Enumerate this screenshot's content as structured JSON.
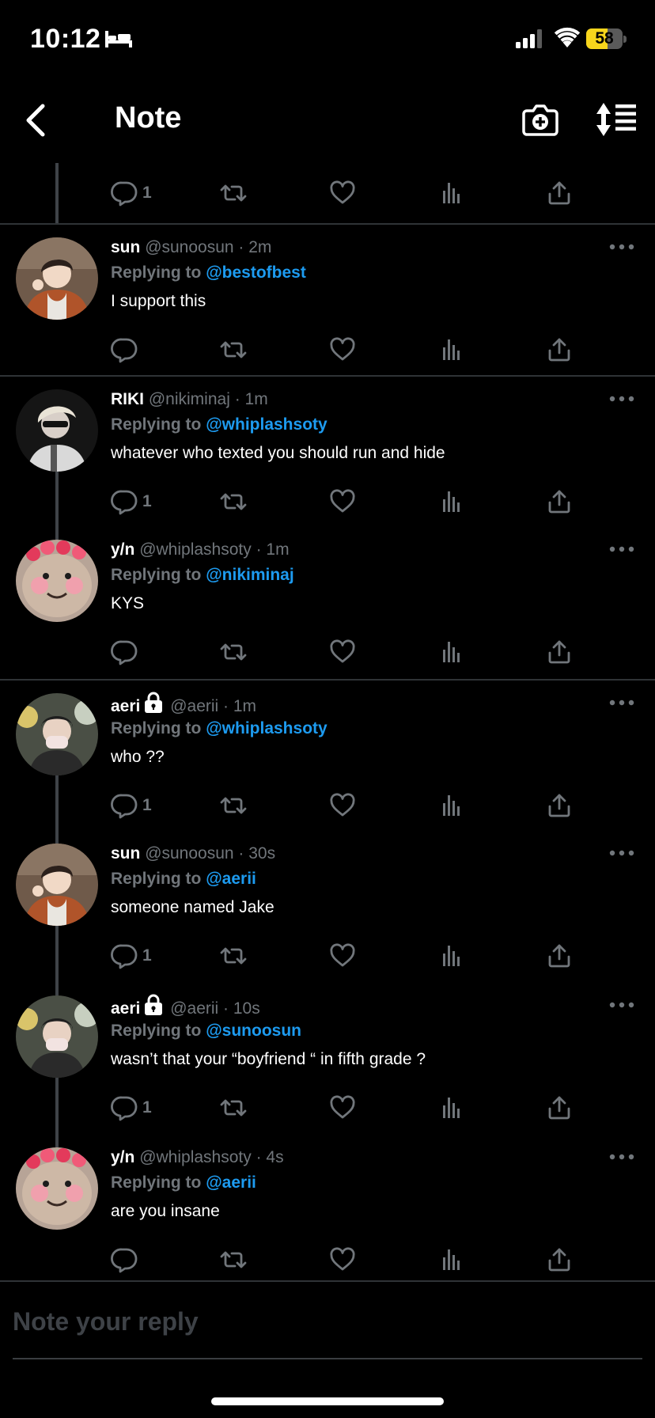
{
  "status_bar": {
    "time": "10:12",
    "battery_level": "58",
    "battery_fraction": 0.58
  },
  "nav": {
    "title": "Note"
  },
  "top_actions": {
    "reply_count": "1"
  },
  "posts": [
    {
      "name": "sun",
      "handle": "@sunoosun · 2m",
      "locked": false,
      "replying_label": "Replying to",
      "mention": "@bestofbest",
      "text": "I support this",
      "reply_count": "",
      "avatar": "sun"
    },
    {
      "name": "RIKI",
      "handle": "@nikiminaj · 1m",
      "locked": false,
      "replying_label": "Replying to",
      "mention": "@whiplashsoty",
      "text": "whatever who texted you should run and hide",
      "reply_count": "1",
      "avatar": "riki"
    },
    {
      "name": "y/n",
      "handle": "@whiplashsoty · 1m",
      "locked": false,
      "replying_label": "Replying to",
      "mention": "@nikiminaj",
      "text": "KYS",
      "reply_count": "",
      "avatar": "yn"
    },
    {
      "name": "aeri",
      "handle": "@aerii · 1m",
      "locked": true,
      "replying_label": "Replying to",
      "mention": "@whiplashsoty",
      "text": "who ??",
      "reply_count": "1",
      "avatar": "aeri"
    },
    {
      "name": "sun",
      "handle": "@sunoosun · 30s",
      "locked": false,
      "replying_label": "Replying to",
      "mention": "@aerii",
      "text": "someone named Jake",
      "reply_count": "1",
      "avatar": "sun"
    },
    {
      "name": "aeri",
      "handle": "@aerii · 10s",
      "locked": true,
      "replying_label": "Replying to",
      "mention": "@sunoosun",
      "text": "wasn’t that your “boyfriend “ in fifth grade ?",
      "reply_count": "1",
      "avatar": "aeri"
    },
    {
      "name": "y/n",
      "handle": "@whiplashsoty · 4s",
      "locked": false,
      "replying_label": "Replying to",
      "mention": "@aerii",
      "text": "are you insane",
      "reply_count": "",
      "avatar": "yn"
    }
  ],
  "composer": {
    "placeholder": "Note your reply"
  },
  "icons": [
    "back-arrow-icon",
    "camera-plus-icon",
    "sort-icon",
    "reply-icon",
    "retweet-icon",
    "like-icon",
    "views-icon",
    "share-icon",
    "more-icon",
    "lock-icon"
  ],
  "colors": {
    "accent": "#1d9bf0",
    "background": "#000000",
    "muted": "#71767b",
    "battery": "#f7d51c"
  }
}
